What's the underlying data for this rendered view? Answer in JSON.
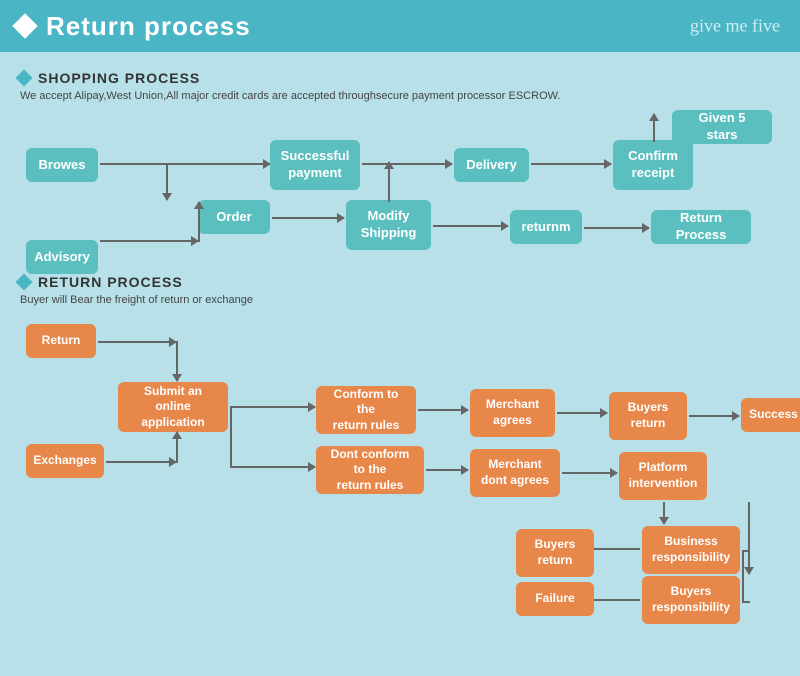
{
  "header": {
    "title": "Return process",
    "brand": "give me five",
    "diamond_color": "#fff"
  },
  "shopping_section": {
    "title": "SHOPPING PROCESS",
    "description": "We accept Alipay,West Union,All major credit cards are accepted throughsecure payment processor ESCROW.",
    "nodes": {
      "browes": "Browes",
      "order": "Order",
      "advisory": "Advisory",
      "modify_shipping": "Modify\nShipping",
      "successful_payment": "Successful\npayment",
      "delivery": "Delivery",
      "confirm_receipt": "Confirm\nreceipt",
      "given_5_stars": "Given 5 stars",
      "returnm": "returnm",
      "return_process": "Return Process"
    }
  },
  "return_section": {
    "title": "RETURN PROCESS",
    "description": "Buyer will Bear the freight of return or exchange",
    "nodes": {
      "return_btn": "Return",
      "exchanges": "Exchanges",
      "submit_online": "Submit an online\napplication",
      "conform_rules": "Conform to the\nreturn rules",
      "dont_conform": "Dont conform to the\nreturn rules",
      "merchant_agrees": "Merchant\nagrees",
      "merchant_dont": "Merchant\ndont agrees",
      "buyers_return_1": "Buyers\nreturn",
      "buyers_return_2": "Buyers\nreturn",
      "platform_intervention": "Platform\nintervention",
      "success": "Success",
      "business_responsibility": "Business\nresponsibility",
      "buyers_responsibility": "Buyers\nresponsibility",
      "failure": "Failure"
    }
  }
}
